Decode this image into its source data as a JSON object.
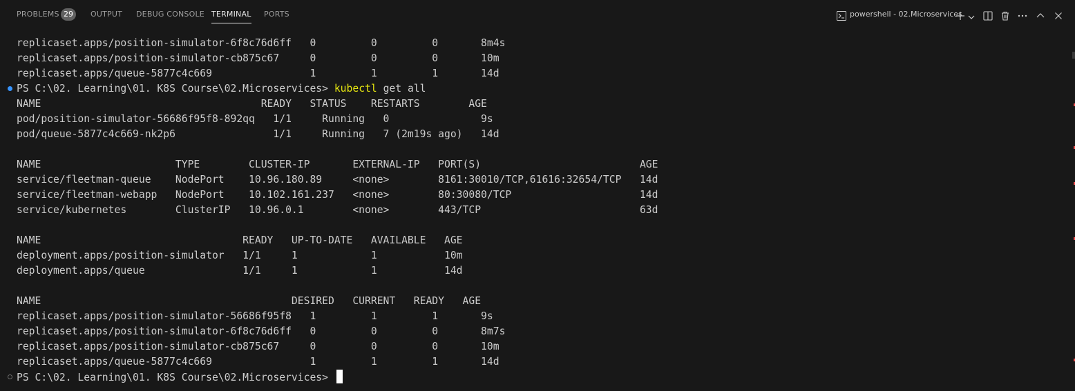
{
  "tabs": [
    {
      "label": "PROBLEMS",
      "badge": "29"
    },
    {
      "label": "OUTPUT"
    },
    {
      "label": "DEBUG CONSOLE"
    },
    {
      "label": "TERMINAL",
      "active": true
    },
    {
      "label": "PORTS"
    }
  ],
  "terminal_title": "powershell - 02.Microservices",
  "colors": {
    "background": "#181818",
    "text": "#cccccc",
    "command": "#e5e510",
    "prompt_dot": "#3794ff"
  },
  "icons": [
    "terminal-icon",
    "plus-icon",
    "chevron-down-icon",
    "split-icon",
    "trash-icon",
    "ellipsis-icon",
    "chevron-up-icon",
    "close-icon"
  ],
  "lines": [
    "replicaset.apps/position-simulator-6f8c76d6ff   0         0         0       8m4s",
    "replicaset.apps/position-simulator-cb875c67     0         0         0       10m",
    "replicaset.apps/queue-5877c4c669                1         1         1       14d",
    {
      "prompt": "PS C:\\02. Learning\\01. K8S Course\\02.Microservices> ",
      "command": "kubectl",
      "args": " get all"
    },
    "NAME                                    READY   STATUS    RESTARTS        AGE",
    "pod/position-simulator-56686f95f8-892qq   1/1     Running   0               9s",
    "pod/queue-5877c4c669-nk2p6                1/1     Running   7 (2m19s ago)   14d",
    "",
    "NAME                      TYPE        CLUSTER-IP       EXTERNAL-IP   PORT(S)                          AGE",
    "service/fleetman-queue    NodePort    10.96.180.89     <none>        8161:30010/TCP,61616:32654/TCP   14d",
    "service/fleetman-webapp   NodePort    10.102.161.237   <none>        80:30080/TCP                     14d",
    "service/kubernetes        ClusterIP   10.96.0.1        <none>        443/TCP                          63d",
    "",
    "NAME                                 READY   UP-TO-DATE   AVAILABLE   AGE",
    "deployment.apps/position-simulator   1/1     1            1           10m",
    "deployment.apps/queue                1/1     1            1           14d",
    "",
    "NAME                                         DESIRED   CURRENT   READY   AGE",
    "replicaset.apps/position-simulator-56686f95f8   1         1         1       9s",
    "replicaset.apps/position-simulator-6f8c76d6ff   0         0         0       8m7s",
    "replicaset.apps/position-simulator-cb875c67     0         0         0       10m",
    "replicaset.apps/queue-5877c4c669                1         1         1       14d",
    {
      "prompt": "PS C:\\02. Learning\\01. K8S Course\\02.Microservices> ",
      "cursor": true
    }
  ]
}
